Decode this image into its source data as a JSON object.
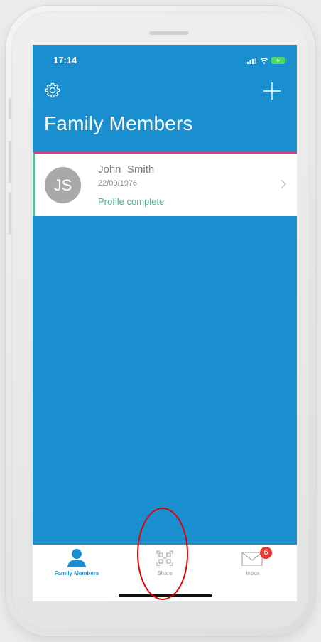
{
  "status_bar": {
    "time": "17:14",
    "icons": [
      "signal-icon",
      "wifi-icon",
      "battery-charging-icon"
    ]
  },
  "header": {
    "settings_icon": "gear-icon",
    "add_icon": "plus-icon",
    "title": "Family Members"
  },
  "members": [
    {
      "initials": "JS",
      "name": "John  Smith",
      "dob": "22/09/1976",
      "status": "Profile complete"
    }
  ],
  "tab_bar": {
    "tabs": [
      {
        "label": "Family Members",
        "icon": "person-icon",
        "active": true
      },
      {
        "label": "Share",
        "icon": "qr-code-icon",
        "active": false
      },
      {
        "label": "Inbox",
        "icon": "envelope-icon",
        "active": false,
        "badge": "6"
      }
    ]
  },
  "colors": {
    "primary": "#1a8fcf",
    "accent_border": "#e9356a",
    "status_green": "#4bb58a",
    "badge_red": "#e8372c",
    "annotation_red": "#e00000"
  }
}
